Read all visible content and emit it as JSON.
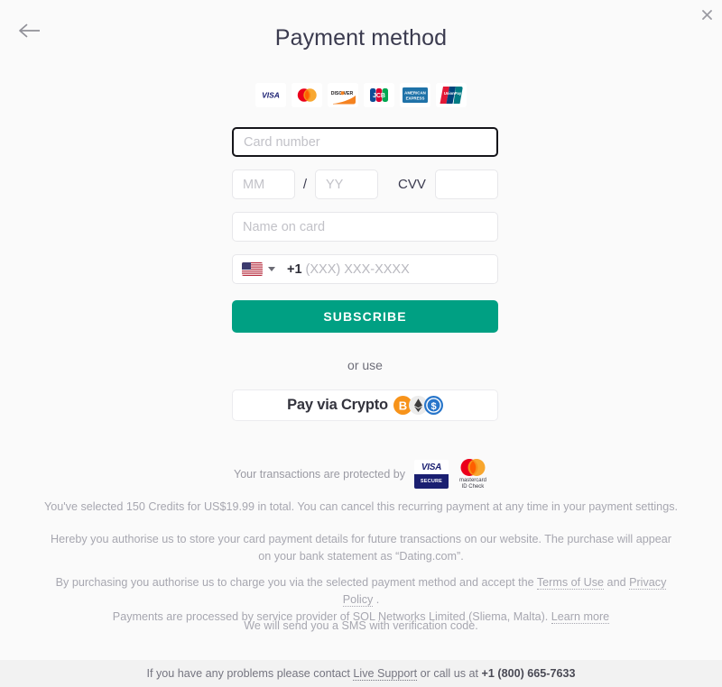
{
  "header": {
    "title": "Payment method",
    "back_icon": "arrow-left-icon",
    "close_icon": "close-icon"
  },
  "card_brands": [
    {
      "name": "visa",
      "label": "VISA"
    },
    {
      "name": "mastercard",
      "label": "mastercard"
    },
    {
      "name": "discover",
      "label": "DISC VER"
    },
    {
      "name": "jcb",
      "label": "JCB"
    },
    {
      "name": "amex",
      "label": "AMERICAN EXPRESS"
    },
    {
      "name": "unionpay",
      "label": "UnionPay"
    }
  ],
  "form": {
    "card_number_placeholder": "Card number",
    "card_number_value": "",
    "month_placeholder": "MM",
    "month_value": "",
    "separator": "/",
    "year_placeholder": "YY",
    "year_value": "",
    "cvv_label": "CVV",
    "cvv_placeholder": "",
    "cvv_value": "",
    "name_placeholder": "Name on card",
    "name_value": "",
    "phone_country": "US",
    "phone_prefix": "+1",
    "phone_placeholder": "(XXX) XXX-XXXX",
    "phone_value": "",
    "submit_label": "SUBSCRIBE",
    "submit_color": "#00a083"
  },
  "alternate": {
    "or_use_label": "or use",
    "crypto_label": "Pay via Crypto",
    "crypto_icons": [
      "bitcoin-icon",
      "ethereum-icon",
      "usdc-icon"
    ]
  },
  "protected": {
    "text": "Your transactions are protected by",
    "visa_secure_top": "VISA",
    "visa_secure_bottom": "SECURE",
    "mastercard_line1": "mastercard",
    "mastercard_line2": "ID Check"
  },
  "legal": {
    "line1": "You've selected 150 Credits for US$19.99 in total. You can cancel this recurring payment at any time in your payment settings.",
    "line2": "Hereby you authorise us to store your card payment details for future transactions on our website. The purchase will appear on your bank statement as “Dating.com”.",
    "line3_prefix": "By purchasing you authorise us to charge you via the selected payment method and accept the ",
    "terms_link": "Terms of Use",
    "line3_mid": " and ",
    "privacy_link": "Privacy Policy",
    "line3_suffix": " .",
    "line3_second": "Payments are processed by service provider of SOL Networks Limited (Sliema, Malta). ",
    "learn_more_link": "Learn more",
    "line4": "We will send you a SMS with verification code."
  },
  "footer": {
    "prefix": "If you have any problems please contact ",
    "support_link": "Live Support",
    "mid": " or call us at ",
    "phone": "+1 (800) 665-7633"
  }
}
